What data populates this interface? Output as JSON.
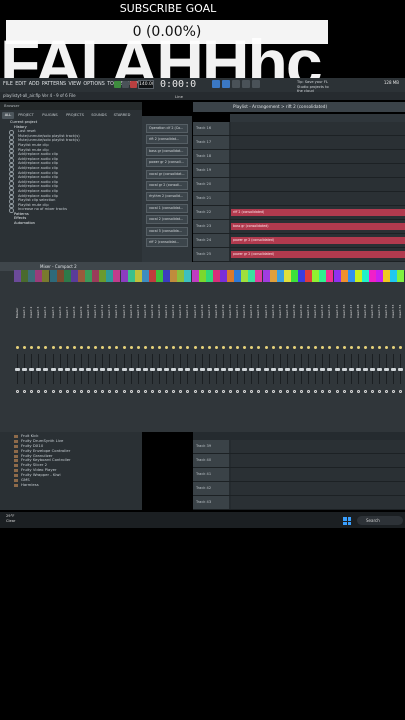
{
  "overlay": {
    "top_caption": "SUBSCRIBE GOAL",
    "score_text": "0 (0.00%)",
    "big_text": "FAI AHHhc"
  },
  "menubar": {
    "items": [
      "FILE",
      "EDIT",
      "ADD",
      "PATTERNS",
      "VIEW",
      "OPTIONS",
      "TOOLS",
      "HELP"
    ],
    "bpm": "140.000",
    "time": "0:00:00",
    "hint": "Tip: Save your FL Studio projects to the cloud",
    "cpu": "128 MB",
    "pattern_select": "Villa flt. Arch #1"
  },
  "toolbar": {
    "file_info": "playlistyt-all_air.flp Ver 4 - 9 of 6 File",
    "playlist_title": "Playlist - Arrangement > rift 2 (consolidated)",
    "snap": "Line"
  },
  "browser": {
    "header": "Browser",
    "tabs": [
      "ALL",
      "PROJECT",
      "PLUGINS",
      "PROJECTS",
      "SOUNDS",
      "STARRED"
    ],
    "current_project": "Current project",
    "history_label": "History",
    "history_items": [
      "Last reset",
      "Mute/unmute/solo playlist track(s)",
      "Mute/unmute/solo playlist track(s)",
      "Playlist mute clip",
      "Playlist mute clip",
      "Add/replace audio clip",
      "Add/replace audio clip",
      "Add/replace audio clip",
      "Add/replace audio clip",
      "Add/replace audio clip",
      "Add/replace audio clip",
      "Add/replace audio clip",
      "Add/replace audio clip",
      "Add/replace audio clip",
      "Add/replace audio clip",
      "Playlist clip selection",
      "Playlist mute clip",
      "Increase no of mixer tracks"
    ],
    "folders": [
      "Patterns",
      "Effects",
      "Automation"
    ]
  },
  "patterns": [
    "Operation clf 2 (Co...",
    "rift 2 (consolidat...",
    "bass gr (consolidat...",
    "power gr 2 (consoli...",
    "vocal gr (consolidat...",
    "vocal gr 2 (consoli...",
    "rhythm 2 (consolid...",
    "vocal 1 (consolidat...",
    "vocal 2 (consolidat...",
    "vocal 5 (consolida...",
    "riff 2 (consolidat..."
  ],
  "playlist_tracks": [
    {
      "label": "Track 16"
    },
    {
      "label": "Track 17"
    },
    {
      "label": "Track 18"
    },
    {
      "label": "Track 19"
    },
    {
      "label": "Track 20"
    },
    {
      "label": "Track 21"
    },
    {
      "label": "Track 22"
    },
    {
      "label": "Track 23"
    },
    {
      "label": "Track 24"
    },
    {
      "label": "Track 25"
    }
  ],
  "playlist_clips": [
    "riff 2 (consolidated)",
    "bass gr (consolidated)",
    "power gr 2 (consolidated)",
    "power gr 2 (consolidated)"
  ],
  "mixer": {
    "title": "Mixer - Compact 2",
    "strip_names": [
      "Master",
      "Insert 1",
      "Insert 2",
      "Insert 3",
      "Insert 4",
      "Insert 5",
      "Insert 6",
      "Insert 7",
      "Insert 8",
      "Insert 9",
      "Insert 10",
      "Insert 11",
      "Insert 12",
      "Insert 13",
      "Insert 14",
      "Insert 15",
      "Insert 16",
      "Insert 17",
      "Insert 18",
      "Insert 19",
      "Insert 20",
      "Insert 21",
      "Insert 22",
      "Insert 23",
      "Insert 24",
      "Insert 25",
      "Insert 26",
      "Insert 27",
      "Insert 28",
      "Insert 29",
      "Insert 30",
      "Insert 31",
      "Insert 32",
      "Insert 33",
      "Insert 34",
      "Insert 35",
      "Insert 36",
      "Insert 37",
      "Insert 38",
      "Insert 39",
      "Insert 40",
      "Insert 41",
      "Insert 42",
      "Insert 43",
      "Insert 44",
      "Insert 45",
      "Insert 46",
      "Insert 47",
      "Insert 48",
      "Insert 49",
      "Insert 50",
      "Insert 51",
      "Insert 52",
      "Insert 53",
      "Insert 54"
    ],
    "strip_colors": [
      "#6b4a9a",
      "#4a6a2e",
      "#3c6d7a",
      "#9a3c7a",
      "#7a7a2e",
      "#2e6a7a",
      "#7a4a2e",
      "#2e7a4a",
      "#5a3c9a",
      "#9a5a3c",
      "#3c9a5a",
      "#9a3c5a",
      "#6a9a2e",
      "#2e9a9a",
      "#c03c8c",
      "#8c3cc0",
      "#3cc08c",
      "#c0c03c",
      "#3c8cc0",
      "#c03c3c",
      "#3cc03c",
      "#3c3cc0",
      "#c08c3c",
      "#8cc03c",
      "#3cc0c0",
      "#c03cc0",
      "#7ad82e",
      "#2ed87a",
      "#d82e7a",
      "#7a2ed8",
      "#d87a2e",
      "#2e7ad8",
      "#a0e03c",
      "#3ce0a0",
      "#e03ca0",
      "#a03ce0",
      "#e0a03c",
      "#3ca0e0",
      "#e0e03c",
      "#3ce03c",
      "#3c3ce0",
      "#e03c3c",
      "#90f030",
      "#30f090",
      "#f03090",
      "#9030f0",
      "#f09030",
      "#3090f0",
      "#c8f020",
      "#20f0c8",
      "#f020c8",
      "#c820f0",
      "#f0c820",
      "#20c8f0",
      "#80f040"
    ]
  },
  "plugins": [
    "Fruit Kick",
    "Fruity DrumSynth Live",
    "Fruity DX10",
    "Fruity Envelope Controller",
    "Fruity Granulizer",
    "Fruity Keyboard Controller",
    "Fruity Slicer 2",
    "Fruity Video Player",
    "Fruity Wrapper - Kiwi",
    "GMS",
    "Harmless"
  ],
  "playlist_lower_tracks": [
    "Track 39",
    "Track 40",
    "Track 41",
    "Track 42",
    "Track 43"
  ],
  "taskbar": {
    "weather_temp": "29°F",
    "weather_desc": "Clear",
    "search_label": "Search"
  },
  "colors": {
    "accent_clip": "#b13a4e",
    "panel_bg": "#2b3135"
  }
}
